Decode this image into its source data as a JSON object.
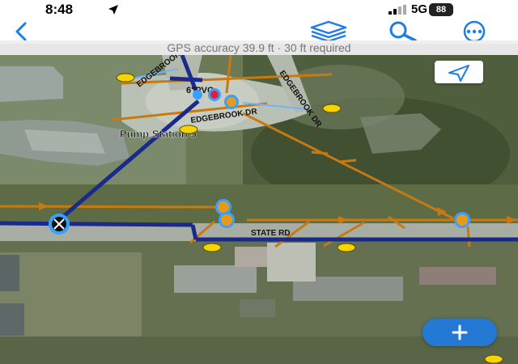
{
  "status_bar": {
    "time": "8:48",
    "network": "5G",
    "battery": "88"
  },
  "nav": {
    "icons": [
      "back-icon",
      "layers-icon",
      "search-icon",
      "more-icon"
    ]
  },
  "gps": {
    "accuracy_text": "GPS accuracy 39.9 ft  ·  30 ft required"
  },
  "map": {
    "labels": {
      "road_nw": "EDGEBROOK DR",
      "road_ne": "EDGEBROOK DR",
      "road_mid": "EDGEBROOK DR",
      "valve": "6\"PVC",
      "pump_station": "Pump Station 5",
      "state_rd": "STATE RD"
    },
    "colors": {
      "water_main": "#1a2a8a",
      "sewer": "#c87a12",
      "selection": "#3aa0ff",
      "accent_button": "#2379d4"
    }
  }
}
